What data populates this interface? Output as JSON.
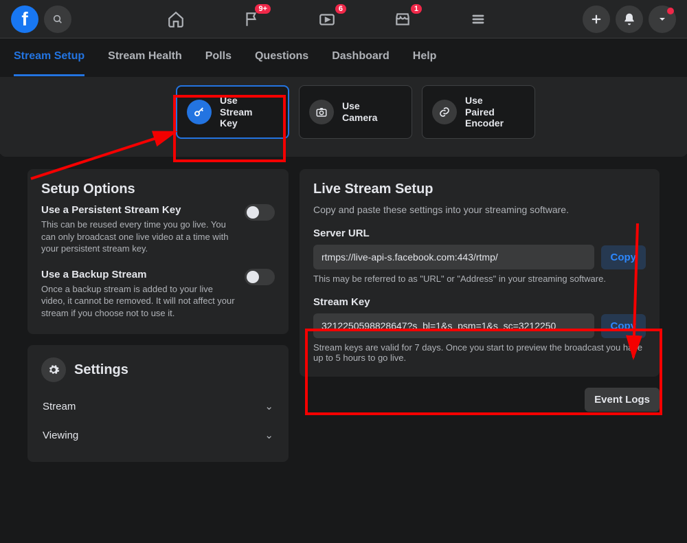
{
  "topbar": {
    "badges": {
      "flag": "9+",
      "video": "6",
      "market": "1"
    }
  },
  "subnav": {
    "items": [
      "Stream Setup",
      "Stream Health",
      "Polls",
      "Questions",
      "Dashboard",
      "Help"
    ],
    "active_index": 0
  },
  "options": {
    "cards": [
      {
        "label": "Use\nStream\nKey"
      },
      {
        "label": "Use\nCamera"
      },
      {
        "label": "Use\nPaired\nEncoder"
      }
    ],
    "selected_index": 0
  },
  "setup_options": {
    "title": "Setup Options",
    "persistent": {
      "title": "Use a Persistent Stream Key",
      "desc": "This can be reused every time you go live. You can only broadcast one live video at a time with your persistent stream key."
    },
    "backup": {
      "title": "Use a Backup Stream",
      "desc": "Once a backup stream is added to your live video, it cannot be removed. It will not affect your stream if you choose not to use it."
    }
  },
  "settings": {
    "title": "Settings",
    "rows": [
      "Stream",
      "Viewing"
    ]
  },
  "live_setup": {
    "title": "Live Stream Setup",
    "subtitle": "Copy and paste these settings into your streaming software.",
    "server": {
      "label": "Server URL",
      "value": "rtmps://live-api-s.facebook.com:443/rtmp/",
      "hint": "This may be referred to as \"URL\" or \"Address\" in your streaming software.",
      "copy": "Copy"
    },
    "key": {
      "label": "Stream Key",
      "value": "3212250598828647?s_bl=1&s_psm=1&s_sc=3212250",
      "hint": "Stream keys are valid for 7 days. Once you start to preview the broadcast you have up to 5 hours to go live.",
      "copy": "Copy"
    }
  },
  "event_logs": "Event Logs"
}
